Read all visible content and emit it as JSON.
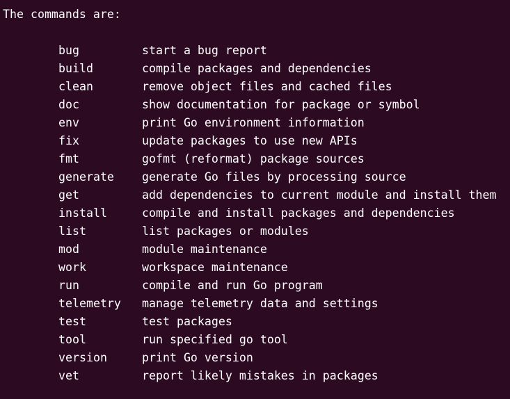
{
  "terminal": {
    "heading": "The commands are:",
    "commands": [
      {
        "name": "bug",
        "desc": "start a bug report"
      },
      {
        "name": "build",
        "desc": "compile packages and dependencies"
      },
      {
        "name": "clean",
        "desc": "remove object files and cached files"
      },
      {
        "name": "doc",
        "desc": "show documentation for package or symbol"
      },
      {
        "name": "env",
        "desc": "print Go environment information"
      },
      {
        "name": "fix",
        "desc": "update packages to use new APIs"
      },
      {
        "name": "fmt",
        "desc": "gofmt (reformat) package sources"
      },
      {
        "name": "generate",
        "desc": "generate Go files by processing source"
      },
      {
        "name": "get",
        "desc": "add dependencies to current module and install them"
      },
      {
        "name": "install",
        "desc": "compile and install packages and dependencies"
      },
      {
        "name": "list",
        "desc": "list packages or modules"
      },
      {
        "name": "mod",
        "desc": "module maintenance"
      },
      {
        "name": "work",
        "desc": "workspace maintenance"
      },
      {
        "name": "run",
        "desc": "compile and run Go program"
      },
      {
        "name": "telemetry",
        "desc": "manage telemetry data and settings"
      },
      {
        "name": "test",
        "desc": "test packages"
      },
      {
        "name": "tool",
        "desc": "run specified go tool"
      },
      {
        "name": "version",
        "desc": "print Go version"
      },
      {
        "name": "vet",
        "desc": "report likely mistakes in packages"
      }
    ]
  },
  "colors": {
    "background": "#2c0a21",
    "text": "#ffffff"
  }
}
